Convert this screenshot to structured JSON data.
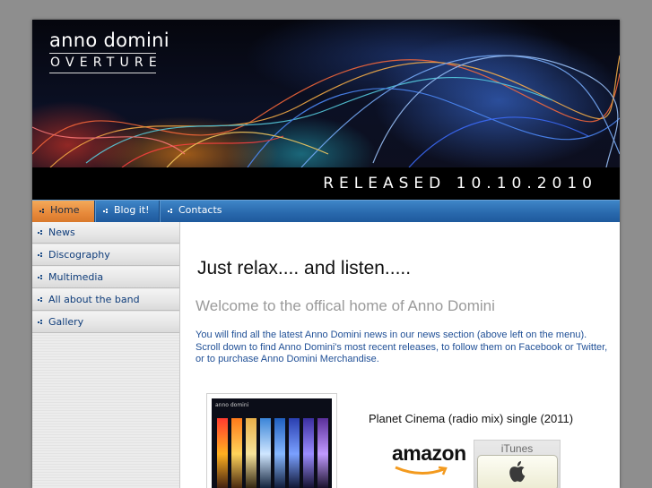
{
  "banner": {
    "logo_title": "anno domini",
    "logo_subtitle": "OVERTURE",
    "release_text": "RELEASED 10.10.2010"
  },
  "topnav": {
    "items": [
      {
        "label": "Home",
        "active": true
      },
      {
        "label": "Blog it!",
        "active": false
      },
      {
        "label": "Contacts",
        "active": false
      }
    ]
  },
  "sidebar": {
    "items": [
      {
        "label": "News"
      },
      {
        "label": "Discography"
      },
      {
        "label": "Multimedia"
      },
      {
        "label": "All about the band"
      },
      {
        "label": "Gallery"
      }
    ]
  },
  "main": {
    "headline": "Just relax.... and listen.....",
    "welcome": "Welcome to the offical home of Anno Domini",
    "intro": "You will find all the latest Anno Domini news in our news section (above left on the menu). Scroll down to find Anno Domini's most recent releases, to follow them on Facebook or Twitter, or to purchase Anno Domini Merchandise.",
    "album_cover_label": "anno domini",
    "single_title": "Planet Cinema (radio mix) single (2011)",
    "amazon_label": "amazon",
    "itunes_label": "iTunes"
  },
  "colors": {
    "nav_blue": "#2a6aae",
    "nav_active_orange": "#e7893a",
    "link_blue": "#1f4f96",
    "page_bg": "#8e8e8e"
  },
  "icons": [
    "nav-bullet-icon",
    "apple-logo-icon",
    "amazon-smile-icon"
  ]
}
